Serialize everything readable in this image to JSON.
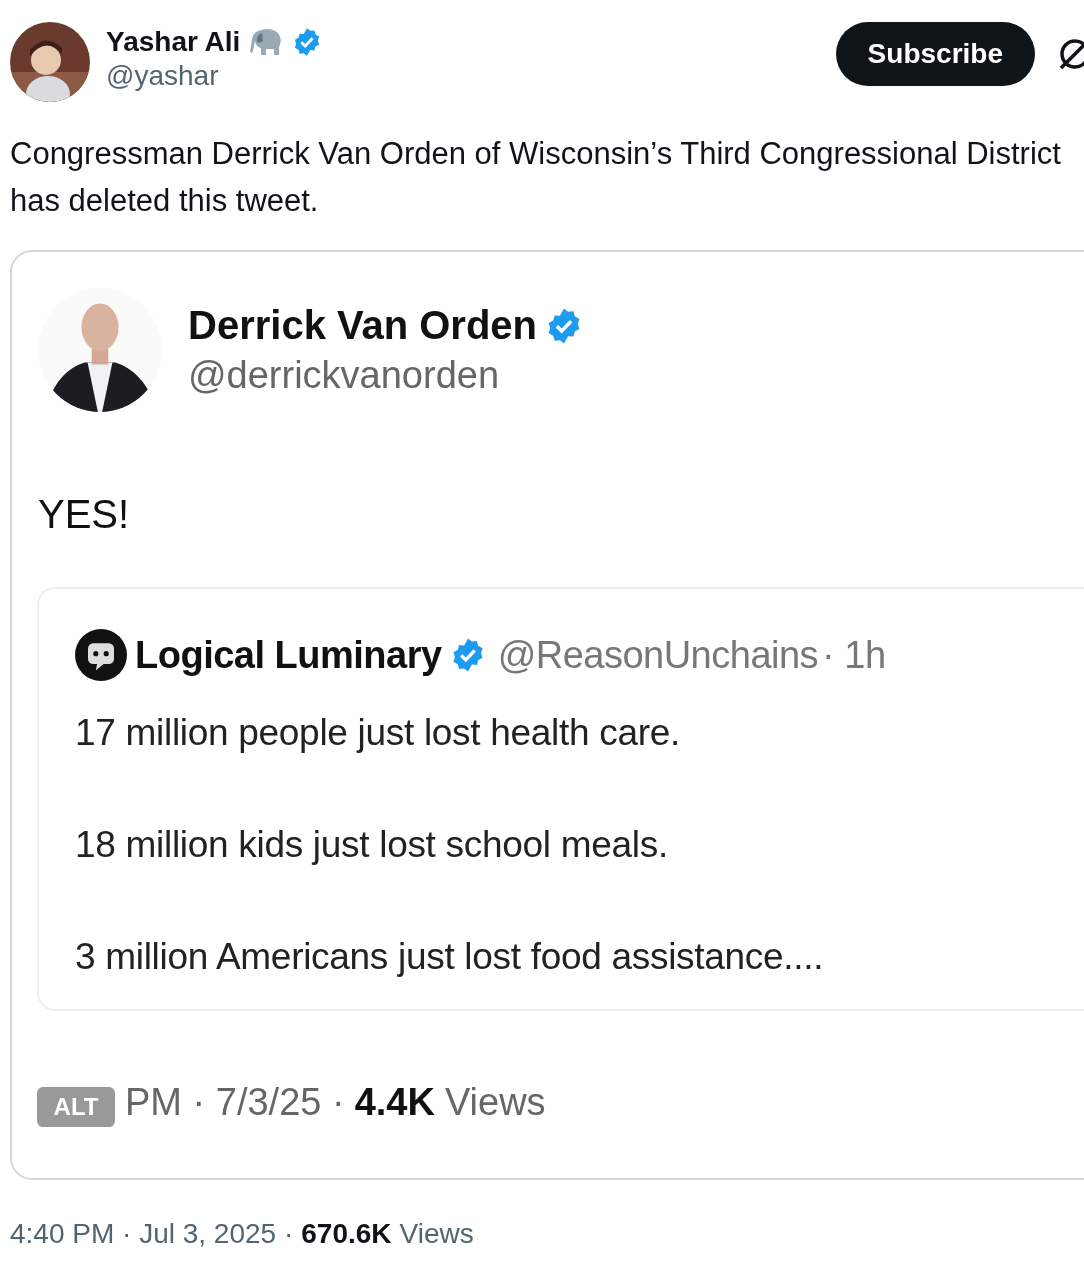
{
  "author": {
    "name": "Yashar Ali",
    "handle": "@yashar",
    "verified": true
  },
  "subscribe_button": "Subscribe",
  "text": "Congressman Derrick Van Orden of Wisconsin’s Third Congressional District has deleted this tweet.",
  "image": {
    "author": {
      "name": "Derrick Van Orden",
      "handle": "@derrickvanorden",
      "verified": true
    },
    "text": "YES!",
    "quote": {
      "name": "Logical Luminary",
      "verified": true,
      "handle": "@ReasonUnchains",
      "time": "· 1h",
      "paragraphs": [
        "17 million people just lost health care.",
        "18 million kids just lost school meals.",
        "3 million Americans just lost food assistance...."
      ]
    },
    "meta": {
      "time": "PM · 7/3/25 ·",
      "views_count": "4.4K",
      "views_label": "Views"
    },
    "alt_badge": "ALT"
  },
  "meta": {
    "time": "4:40 PM · Jul 3, 2025 ·",
    "views_count": "670.6K",
    "views_label": "Views"
  }
}
